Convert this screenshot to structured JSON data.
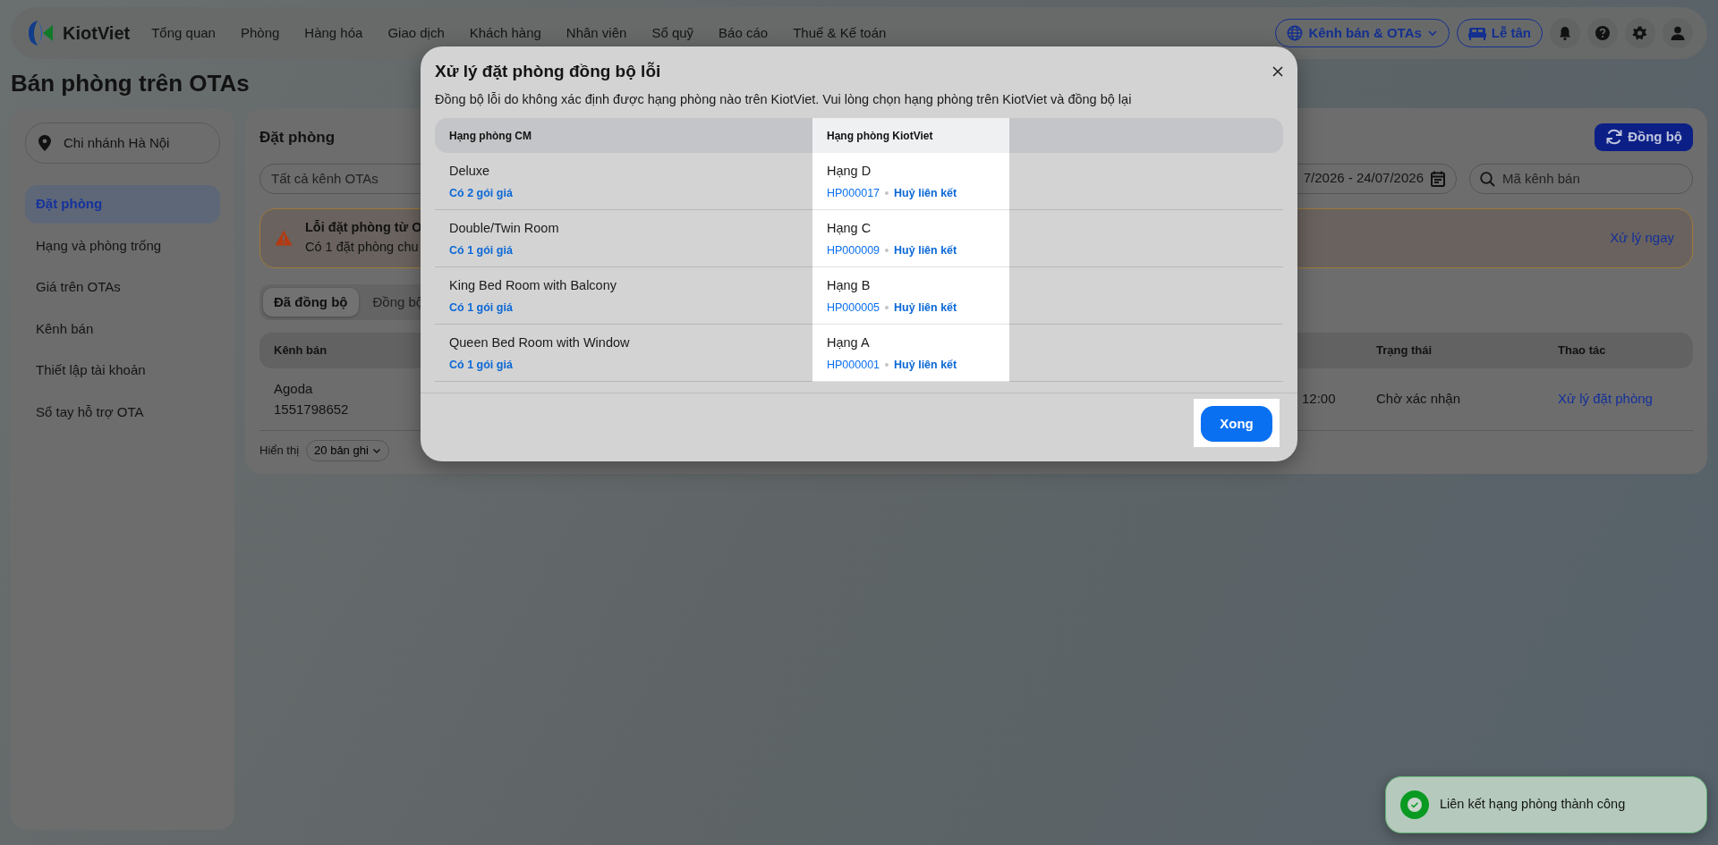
{
  "nav": {
    "brand": "KiotViet",
    "items": [
      "Tổng quan",
      "Phòng",
      "Hàng hóa",
      "Giao dịch",
      "Khách hàng",
      "Nhân viên",
      "Sổ quỹ",
      "Báo cáo",
      "Thuế & Kế toán"
    ],
    "channel_button": "Kênh bán & OTAs",
    "reception_button": "Lễ tân"
  },
  "page_title": "Bán phòng trên OTAs",
  "sidebar": {
    "branch": "Chi nhánh Hà Nội",
    "items": [
      {
        "label": "Đặt phòng",
        "selected": true
      },
      {
        "label": "Hạng và phòng trống",
        "selected": false
      },
      {
        "label": "Giá trên OTAs",
        "selected": false
      },
      {
        "label": "Kênh bán",
        "selected": false
      },
      {
        "label": "Thiết lập tài khoản",
        "selected": false
      },
      {
        "label": "Sổ tay hỗ trợ OTA",
        "selected": false
      }
    ]
  },
  "main": {
    "title": "Đặt phòng",
    "sync_button": "Đồng bộ",
    "channel_filter": {
      "placeholder": "Tất cả kênh OTAs"
    },
    "date_range": "7/2026 - 24/07/2026",
    "search": {
      "placeholder": "Mã kênh bán"
    },
    "alert": {
      "title": "Lỗi đặt phòng từ O",
      "text": "Có 1 đặt phòng chu",
      "action": "Xử lý ngay"
    },
    "tabs": [
      {
        "label": "Đã đồng bộ",
        "selected": true
      },
      {
        "label": "Đồng bộ",
        "selected": false
      }
    ],
    "table": {
      "columns": [
        "Kênh bán",
        "Trạng thái",
        "Thao tác"
      ],
      "rows": [
        {
          "channel": "Agoda",
          "code": "1551798652",
          "time": "12:00",
          "status": "Chờ xác nhận",
          "action": "Xử lý đặt phòng"
        }
      ]
    },
    "page_size": {
      "label": "Hiển thị",
      "value": "20 bản ghi"
    }
  },
  "dialog": {
    "title": "Xử lý đặt phòng đồng bộ lỗi",
    "description": "Đồng bộ lỗi do không xác định được hạng phòng nào trên KiotViet. Vui lòng chọn hạng phòng trên KiotViet và đồng bộ lại",
    "columns": [
      "Hạng phòng CM",
      "Hạng phòng KiotViet"
    ],
    "rows": [
      {
        "cm_room": "Deluxe",
        "rate_plans": "Có 2 gói giá",
        "kv_room": "Hạng D",
        "kv_code": "HP000017",
        "unlink": "Huỷ liên kết"
      },
      {
        "cm_room": "Double/Twin Room",
        "rate_plans": "Có 1 gói giá",
        "kv_room": "Hạng C",
        "kv_code": "HP000009",
        "unlink": "Huỷ liên kết"
      },
      {
        "cm_room": "King Bed Room with Balcony",
        "rate_plans": "Có 1 gói giá",
        "kv_room": "Hạng B",
        "kv_code": "HP000005",
        "unlink": "Huỷ liên kết"
      },
      {
        "cm_room": "Queen Bed Room with Window",
        "rate_plans": "Có 1 gói giá",
        "kv_room": "Hạng A",
        "kv_code": "HP000001",
        "unlink": "Huỷ liên kết"
      }
    ],
    "done_button": "Xong"
  },
  "toast": {
    "message": "Liên kết hạng phòng thành công"
  }
}
